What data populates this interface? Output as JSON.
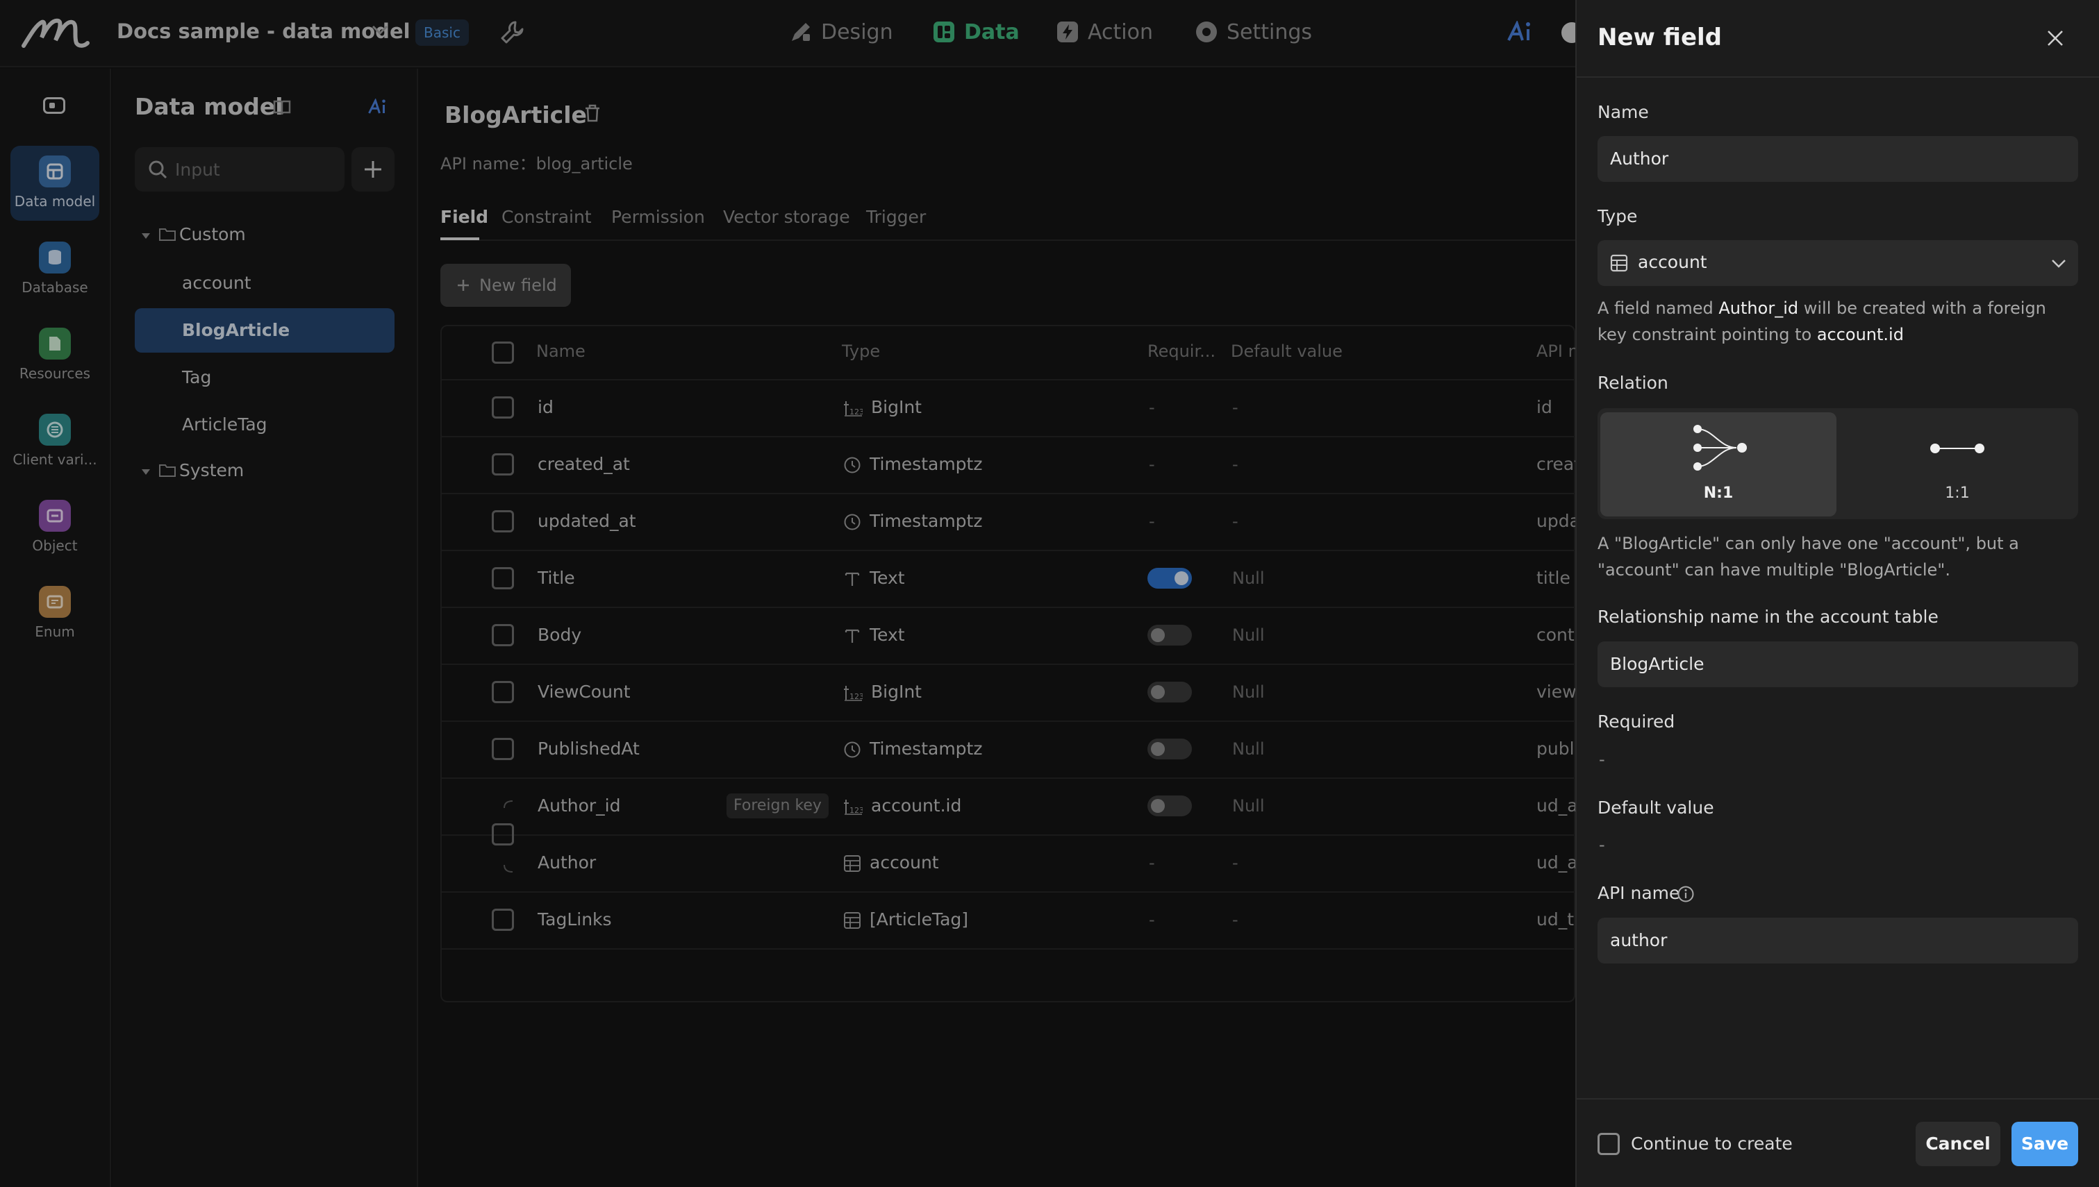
{
  "topbar": {
    "project_title": "Docs sample - data model",
    "plan_badge": "Basic",
    "tabs": [
      {
        "label": "Design",
        "icon": "design-icon"
      },
      {
        "label": "Data",
        "icon": "data-icon",
        "active": true
      },
      {
        "label": "Action",
        "icon": "action-icon"
      },
      {
        "label": "Settings",
        "icon": "settings-icon"
      }
    ],
    "ai_label": "Ai"
  },
  "rail": {
    "items": [
      {
        "label": "Data model",
        "active": true
      },
      {
        "label": "Database"
      },
      {
        "label": "Resources"
      },
      {
        "label": "Client vari..."
      },
      {
        "label": "Object"
      },
      {
        "label": "Enum"
      }
    ]
  },
  "sidebar": {
    "title": "Data model",
    "ai_label": "Ai",
    "search_placeholder": "Input",
    "groups": [
      {
        "label": "Custom",
        "items": [
          "account",
          "BlogArticle",
          "Tag",
          "ArticleTag"
        ],
        "selected": "BlogArticle"
      },
      {
        "label": "System",
        "items": []
      }
    ]
  },
  "entity": {
    "title": "BlogArticle",
    "api_name_label": "API name：",
    "api_name_value": "blog_article",
    "tabs": [
      "Field",
      "Constraint",
      "Permission",
      "Vector storage",
      "Trigger"
    ],
    "new_field_label": "New field",
    "columns": [
      "Name",
      "Type",
      "Requir...",
      "Default value",
      "API n"
    ],
    "rows": [
      {
        "name": "id",
        "type": "BigInt",
        "type_icon": "number-icon",
        "required": "-",
        "default": "-",
        "api": "id"
      },
      {
        "name": "created_at",
        "type": "Timestamptz",
        "type_icon": "clock-icon",
        "required": "-",
        "default": "-",
        "api": "creat"
      },
      {
        "name": "updated_at",
        "type": "Timestamptz",
        "type_icon": "clock-icon",
        "required": "-",
        "default": "-",
        "api": "upda"
      },
      {
        "name": "Title",
        "type": "Text",
        "type_icon": "text-icon",
        "required": "toggle-on",
        "default": "Null",
        "api": "title"
      },
      {
        "name": "Body",
        "type": "Text",
        "type_icon": "text-icon",
        "required": "toggle-off",
        "default": "Null",
        "api": "conte"
      },
      {
        "name": "ViewCount",
        "type": "BigInt",
        "type_icon": "number-icon",
        "required": "toggle-off",
        "default": "Null",
        "api": "view_"
      },
      {
        "name": "PublishedAt",
        "type": "Timestamptz",
        "type_icon": "clock-icon",
        "required": "toggle-off",
        "default": "Null",
        "api": "publi"
      },
      {
        "name": "Author_id",
        "type": "account.id",
        "type_icon": "number-icon",
        "required": "toggle-off",
        "default": "Null",
        "api": "ud_a",
        "badge": "Foreign key"
      },
      {
        "name": "Author",
        "type": "account",
        "type_icon": "table-icon",
        "required": "-",
        "default": "-",
        "api": "ud_a"
      },
      {
        "name": "TagLinks",
        "type": "[ArticleTag]",
        "type_icon": "table-icon",
        "required": "-",
        "default": "-",
        "api": "ud_t"
      }
    ]
  },
  "panel": {
    "title": "New field",
    "name_label": "Name",
    "name_value": "Author",
    "type_label": "Type",
    "type_value": "account",
    "fk_help": {
      "pre": "A field named ",
      "field": "Author_id",
      "mid": " will be created with a foreign key constraint pointing to ",
      "target": "account.id"
    },
    "relation_label": "Relation",
    "relation_options": [
      {
        "label": "N:1",
        "selected": true
      },
      {
        "label": "1:1",
        "selected": false
      }
    ],
    "relation_help": "A \"BlogArticle\" can only have one \"account\", but a \"account\" can have multiple \"BlogArticle\".",
    "rel_name_label": "Relationship name in the account table",
    "rel_name_value": "BlogArticle",
    "required_label": "Required",
    "required_value": "-",
    "default_label": "Default value",
    "default_value": "-",
    "api_label": "API name",
    "api_value": "author",
    "continue_label": "Continue to create",
    "cancel_label": "Cancel",
    "save_label": "Save"
  },
  "colors": {
    "accent_green": "#3fb27a",
    "accent_blue": "#4a9ef0",
    "selected_bg": "#24446e"
  }
}
